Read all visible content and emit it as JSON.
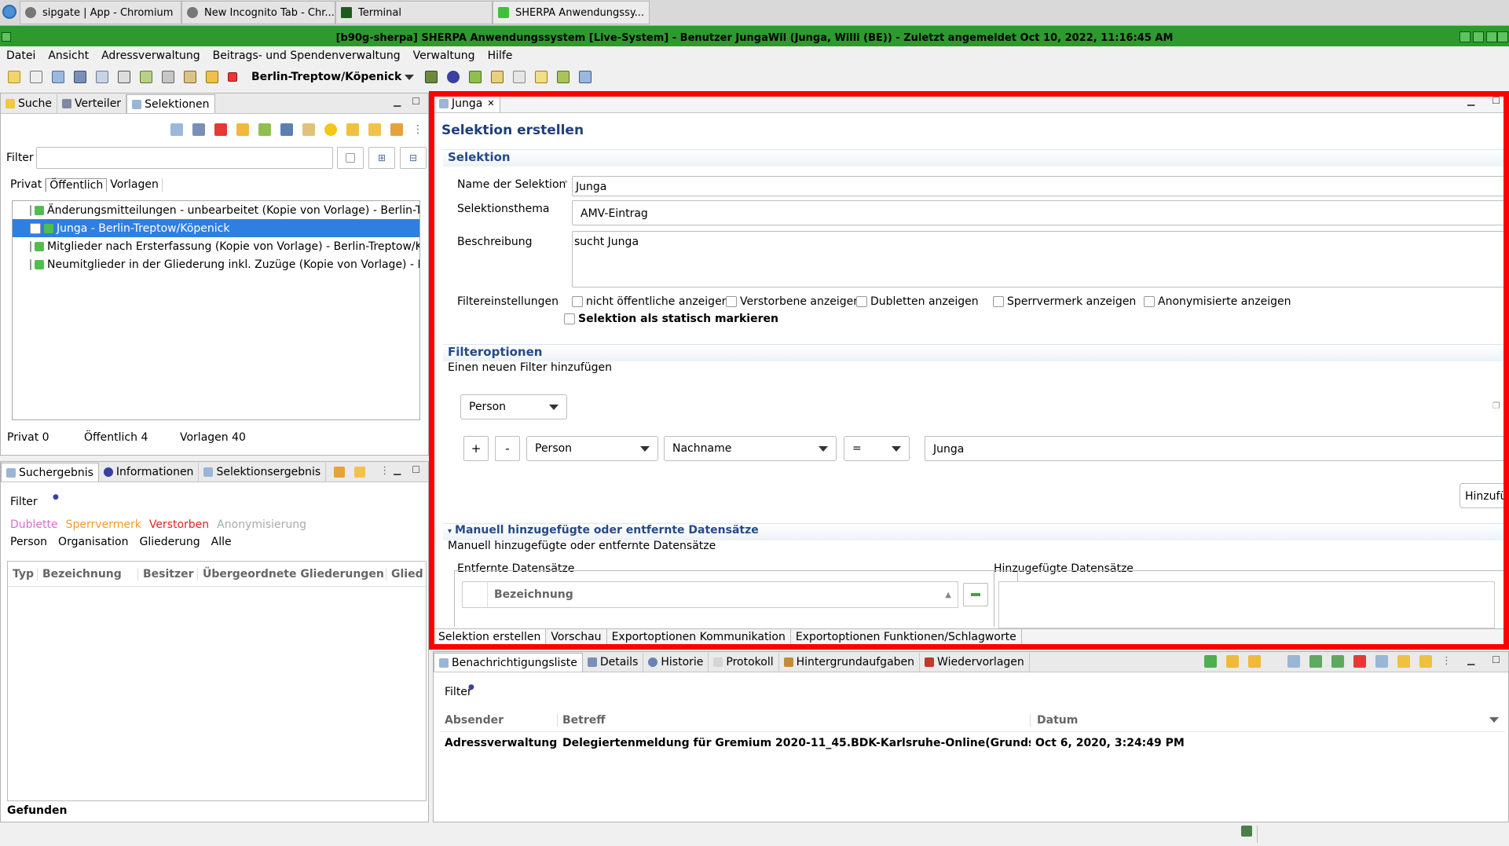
{
  "taskbar": {
    "items": [
      {
        "label": "sipgate | App - Chromium"
      },
      {
        "label": "New Incognito Tab - Chr..."
      },
      {
        "label": "Terminal"
      },
      {
        "label": "SHERPA Anwendungssy..."
      }
    ]
  },
  "window": {
    "title": "[b90g-sherpa] SHERPA Anwendungssystem [Live-System] - Benutzer JungaWil (Junga, Willi (BE)) - Zuletzt angemeldet Oct 10, 2022, 11:16:45 AM"
  },
  "menu": [
    "Datei",
    "Ansicht",
    "Adressverwaltung",
    "Beitrags- und Spendenverwaltung",
    "Verwaltung",
    "Hilfe"
  ],
  "toolbar": {
    "org_selector": "Berlin-Treptow/Köpenick"
  },
  "left_top": {
    "tabs": [
      "Suche",
      "Verteiler",
      "Selektionen"
    ],
    "filter_label": "Filter",
    "filter_value": "",
    "subtabs": [
      "Privat",
      "Öffentlich",
      "Vorlagen"
    ],
    "items": [
      "Änderungsmitteilungen - unbearbeitet (Kopie von Vorlage) - Berlin-Treptow/Köpenick",
      "Junga - Berlin-Treptow/Köpenick",
      "Mitglieder nach Ersterfassung (Kopie von Vorlage) - Berlin-Treptow/Köpenick",
      "Neumitglieder in der Gliederung inkl. Zuzüge (Kopie von Vorlage) - Berlin-Treptow/Köpenick"
    ],
    "counts": {
      "privat": "Privat 0",
      "oeffentlich": "Öffentlich 4",
      "vorlagen": "Vorlagen 40"
    }
  },
  "left_bottom": {
    "tabs": [
      "Suchergebnis",
      "Informationen",
      "Selektionsergebnis"
    ],
    "filter_label": "Filter",
    "legend": [
      {
        "label": "Dublette",
        "color": "#d36fd3"
      },
      {
        "label": "Sperrvermerk",
        "color": "#f39c27"
      },
      {
        "label": "Verstorben",
        "color": "#e0261f"
      },
      {
        "label": "Anonymisierung",
        "color": "#aaaaaa"
      }
    ],
    "types": [
      "Person",
      "Organisation",
      "Gliederung",
      "Alle"
    ],
    "columns": [
      "Typ",
      "Bezeichnung",
      "Besitzer",
      "Übergeordnete Gliederungen",
      "Glied"
    ],
    "status": "Gefunden"
  },
  "editor": {
    "tab": "Junga",
    "heading": "Selektion erstellen",
    "section_selektion": "Selektion",
    "name_label": "Name der Selektion",
    "name_value": "Junga",
    "thema_label": "Selektionsthema",
    "thema_value": "AMV-Eintrag",
    "beschreibung_label": "Beschreibung",
    "beschreibung_value": "sucht Junga",
    "filtereinstellungen_label": "Filtereinstellungen",
    "checkboxes": [
      "nicht öffentliche anzeigen",
      "Verstorbene anzeigen",
      "Dubletten anzeigen",
      "Sperrvermerk anzeigen",
      "Anonymisierte anzeigen"
    ],
    "statisch_label": "Selektion als statisch markieren",
    "section_filteroptionen": "Filteroptionen",
    "filter_hint": "Einen neuen Filter hinzufügen",
    "filter_type": "Person",
    "filter_row": {
      "plus": "+",
      "minus": "-",
      "entity": "Person",
      "field": "Nachname",
      "op": "=",
      "value": "Junga"
    },
    "add_button": "Hinzufügen",
    "section_manuell": "Manuell hinzugefügte oder entfernte Datensätze",
    "manuell_hint": "Manuell hinzugefügte oder entfernte Datensätze",
    "removed_label": "Entfernte Datensätze",
    "added_label": "Hinzugefügte Datensätze",
    "removed_column": "Bezeichnung",
    "bottom_tabs": [
      "Selektion erstellen",
      "Vorschau",
      "Exportoptionen Kommunikation",
      "Exportoptionen Funktionen/Schlagworte"
    ]
  },
  "notifications": {
    "tabs": [
      "Benachrichtigungsliste",
      "Details",
      "Historie",
      "Protokoll",
      "Hintergrundaufgaben",
      "Wiedervorlagen"
    ],
    "filter_label": "Filter",
    "columns": [
      "Absender",
      "Betreff",
      "Datum"
    ],
    "rows": [
      {
        "absender": "Adressverwaltung",
        "betreff": "Delegiertenmeldung für Gremium 2020-11_45.BDK-Karlsruhe-Online(Grundsatz",
        "datum": "Oct 6, 2020, 3:24:49 PM"
      }
    ]
  }
}
